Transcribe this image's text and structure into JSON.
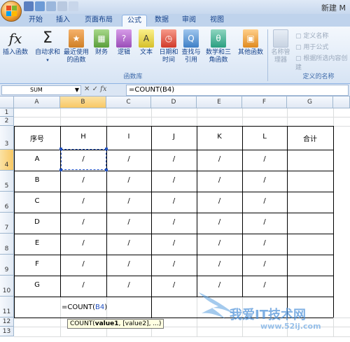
{
  "window": {
    "title": "新建 M"
  },
  "tabs": [
    "开始",
    "插入",
    "页面布局",
    "公式",
    "数据",
    "审阅",
    "视图"
  ],
  "ribbon": {
    "buttons": [
      {
        "label": "插入函数",
        "icon": "fx-icon"
      },
      {
        "label": "自动求和",
        "icon": "sigma-icon"
      },
      {
        "label": "最近使用的函数",
        "icon": "book-icon"
      },
      {
        "label": "财务",
        "icon": "book-icon"
      },
      {
        "label": "逻辑",
        "icon": "book-icon"
      },
      {
        "label": "文本",
        "icon": "book-icon"
      },
      {
        "label": "日期和时间",
        "icon": "book-icon"
      },
      {
        "label": "查找与引用",
        "icon": "book-icon"
      },
      {
        "label": "数学和三角函数",
        "icon": "book-icon"
      },
      {
        "label": "其他函数",
        "icon": "book-icon"
      },
      {
        "label": "名称管理器",
        "icon": "name-manager-icon"
      }
    ],
    "group_functions": "函数库",
    "group_names": "定义的名称",
    "small": {
      "define_name": "定义名称",
      "use_in_formula": "用于公式",
      "create_from_selection": "根据所选内容创建"
    },
    "fx_symbol": "fx",
    "sigma_symbol": "Σ",
    "book_glyphs": [
      "★",
      "▦",
      "?",
      "A",
      "◷",
      "Q",
      "θ",
      "▣"
    ]
  },
  "formula_bar": {
    "name_box": "SUM",
    "formula": "=COUNT(B4)",
    "fx": "fx"
  },
  "columns": [
    "A",
    "B",
    "C",
    "D",
    "E",
    "F",
    "G"
  ],
  "rows": [
    "1",
    "2",
    "3",
    "4",
    "5",
    "6",
    "7",
    "8",
    "9",
    "10",
    "11",
    "12",
    "13"
  ],
  "table": {
    "header": [
      "序号",
      "H",
      "I",
      "J",
      "K",
      "L",
      "合计"
    ],
    "rows": [
      [
        "A",
        "/",
        "/",
        "/",
        "/",
        "/",
        ""
      ],
      [
        "B",
        "/",
        "/",
        "/",
        "/",
        "/",
        ""
      ],
      [
        "C",
        "/",
        "/",
        "/",
        "/",
        "/",
        ""
      ],
      [
        "D",
        "/",
        "/",
        "/",
        "/",
        "/",
        ""
      ],
      [
        "E",
        "/",
        "/",
        "/",
        "/",
        "/",
        ""
      ],
      [
        "F",
        "/",
        "/",
        "/",
        "/",
        "/",
        ""
      ],
      [
        "G",
        "/",
        "/",
        "/",
        "/",
        "/",
        ""
      ]
    ],
    "edit_formula": "=COUNT(",
    "edit_ref": "B4",
    "edit_close": ")"
  },
  "tooltip": {
    "fn": "COUNT(",
    "arg1": "value1",
    "rest": ", [value2], ...)"
  },
  "watermark": {
    "main": "我爱IT技术网",
    "url": "www.52ij.com"
  },
  "colors": {
    "accent": "#15428b",
    "selected_header": "#f8c864",
    "ref_blue": "#2050c0"
  }
}
